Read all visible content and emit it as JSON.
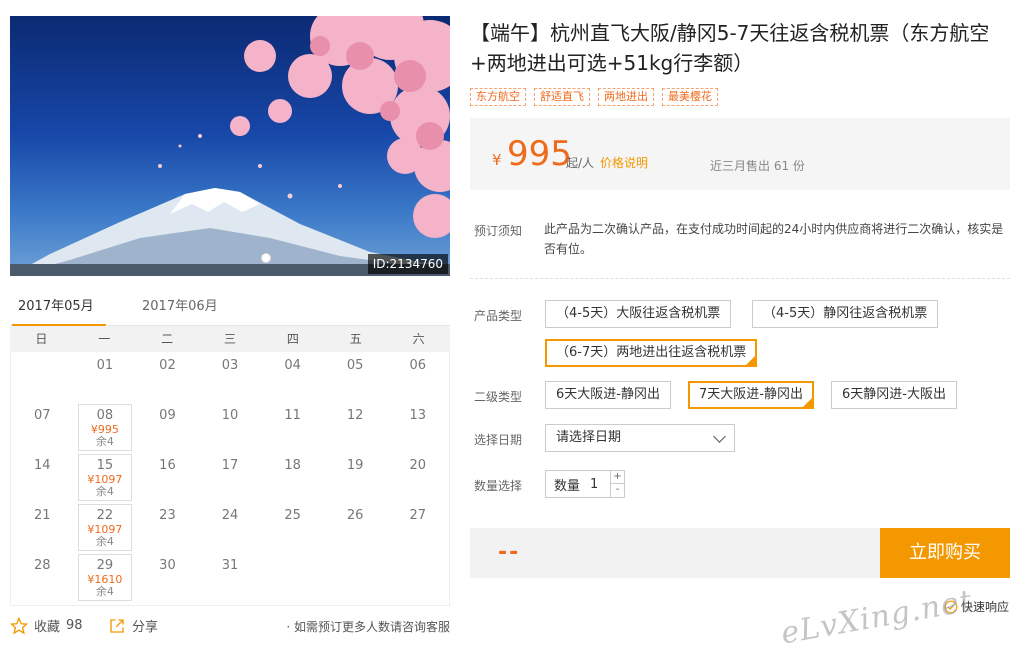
{
  "hero": {
    "id_badge": "ID:2134760"
  },
  "calendar": {
    "tabs": [
      "2017年05月",
      "2017年06月"
    ],
    "weekdays": [
      "日",
      "一",
      "二",
      "三",
      "四",
      "五",
      "六"
    ],
    "weeks": [
      [
        {
          "d": ""
        },
        {
          "d": "01"
        },
        {
          "d": "02"
        },
        {
          "d": "03"
        },
        {
          "d": "04"
        },
        {
          "d": "05"
        },
        {
          "d": "06"
        }
      ],
      [
        {
          "d": "07"
        },
        {
          "d": "08",
          "price": "¥995",
          "left": "余4"
        },
        {
          "d": "09"
        },
        {
          "d": "10"
        },
        {
          "d": "11"
        },
        {
          "d": "12"
        },
        {
          "d": "13"
        }
      ],
      [
        {
          "d": "14"
        },
        {
          "d": "15",
          "price": "¥1097",
          "left": "余4"
        },
        {
          "d": "16"
        },
        {
          "d": "17"
        },
        {
          "d": "18"
        },
        {
          "d": "19"
        },
        {
          "d": "20"
        }
      ],
      [
        {
          "d": "21"
        },
        {
          "d": "22",
          "price": "¥1097",
          "left": "余4"
        },
        {
          "d": "23"
        },
        {
          "d": "24"
        },
        {
          "d": "25"
        },
        {
          "d": "26"
        },
        {
          "d": "27"
        }
      ],
      [
        {
          "d": "28"
        },
        {
          "d": "29",
          "price": "¥1610",
          "left": "余4"
        },
        {
          "d": "30"
        },
        {
          "d": "31"
        },
        {
          "d": ""
        },
        {
          "d": ""
        },
        {
          "d": ""
        }
      ]
    ]
  },
  "footer": {
    "fav_label": "收藏",
    "fav_count": "98",
    "share_label": "分享",
    "consult": "· 如需预订更多人数请咨询客服"
  },
  "product": {
    "title": "【端午】杭州直飞大阪/静冈5-7天往返含税机票（东方航空+两地进出可选+51kg行李额）",
    "tags": [
      "东方航空",
      "舒适直飞",
      "两地进出",
      "最美樱花"
    ],
    "price": {
      "currency": "¥",
      "amount": "995",
      "unit": "起/人",
      "note": "价格说明",
      "sold": "近三月售出 61 份"
    },
    "notice_label": "预订须知",
    "notice": "此产品为二次确认产品，在支付成功时间起的24小时内供应商将进行二次确认，核实是否有位。",
    "type_label": "产品类型",
    "types": [
      "（4-5天）大阪往返含税机票",
      "（4-5天）静冈往返含税机票",
      "（6-7天）两地进出往返含税机票"
    ],
    "subtype_label": "二级类型",
    "subtypes": [
      "6天大阪进-静冈出",
      "7天大阪进-静冈出",
      "6天静冈进-大阪出"
    ],
    "date_label": "选择日期",
    "date_placeholder": "请选择日期",
    "qty_label": "数量选择",
    "qty_field_label": "数量",
    "qty_value": "1",
    "qty_plus": "+",
    "qty_minus": "-",
    "total": "--",
    "buy": "立即购买",
    "quick": "快速响应"
  },
  "watermark": "eLvXing.net",
  "colors": {
    "accent": "#f39800",
    "price": "#f06a1b"
  }
}
